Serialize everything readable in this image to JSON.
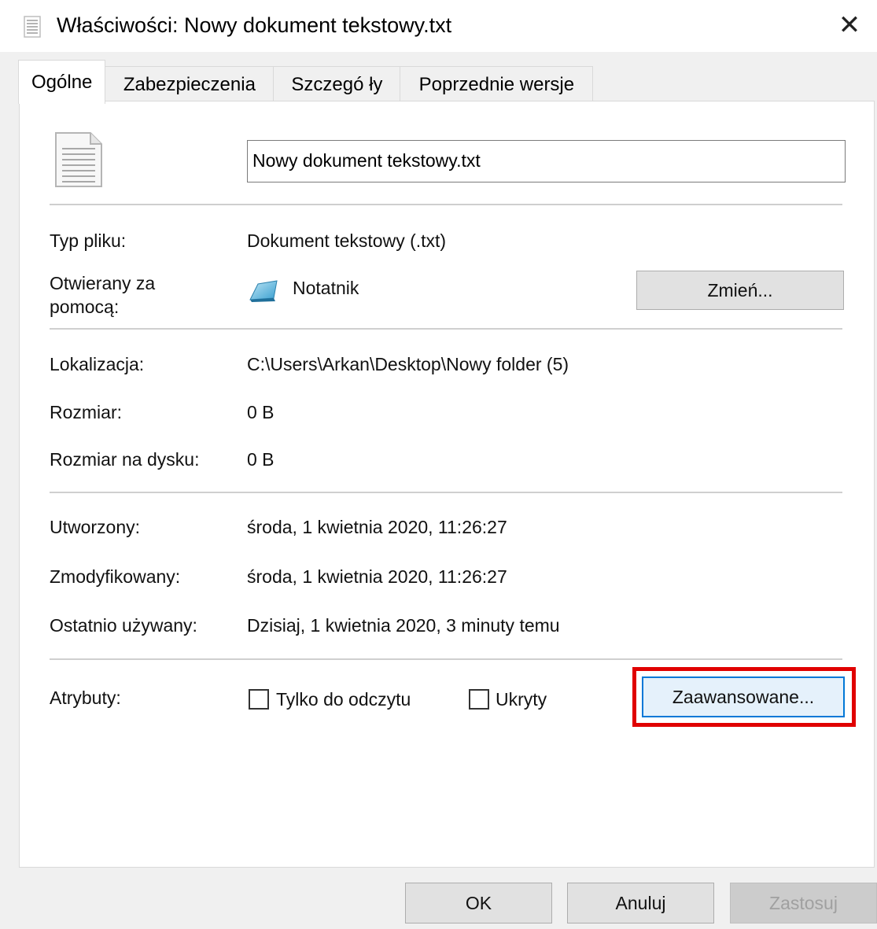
{
  "window": {
    "title": "Właściwości: Nowy dokument tekstowy.txt",
    "close_glyph": "✕"
  },
  "tabs": [
    {
      "label": "Ogólne",
      "active": true
    },
    {
      "label": "Zabezpieczenia",
      "active": false
    },
    {
      "label": "Szczegó ły",
      "active": false
    },
    {
      "label": "Poprzednie wersje",
      "active": false
    }
  ],
  "general": {
    "file_name": "Nowy dokument tekstowy.txt",
    "file_type_label": "Typ pliku:",
    "file_type_value": "Dokument tekstowy (.txt)",
    "opens_with_label_line1": "Otwierany za",
    "opens_with_label_line2": "pomocą:",
    "opens_with_value": "Notatnik",
    "change_button": "Zmień...",
    "location_label": "Lokalizacja:",
    "location_value": "C:\\Users\\Arkan\\Desktop\\Nowy folder (5)",
    "size_label": "Rozmiar:",
    "size_value": "0 B",
    "size_on_disk_label": "Rozmiar na dysku:",
    "size_on_disk_value": "0 B",
    "created_label": "Utworzony:",
    "created_value": "środa, 1 kwietnia 2020, 11:26:27",
    "modified_label": "Zmodyfikowany:",
    "modified_value": "środa, 1 kwietnia 2020, 11:26:27",
    "accessed_label": "Ostatnio używany:",
    "accessed_value": "Dzisiaj, 1 kwietnia 2020, 3 minuty temu",
    "attributes_label": "Atrybuty:",
    "readonly_label": "Tylko do odczytu",
    "readonly_checked": false,
    "hidden_label": "Ukryty",
    "hidden_checked": false,
    "advanced_button": "Zaawansowane..."
  },
  "footer": {
    "ok": "OK",
    "cancel": "Anuluj",
    "apply": "Zastosuj"
  },
  "colors": {
    "highlight": "#e00000",
    "focus_border": "#0078d7"
  }
}
